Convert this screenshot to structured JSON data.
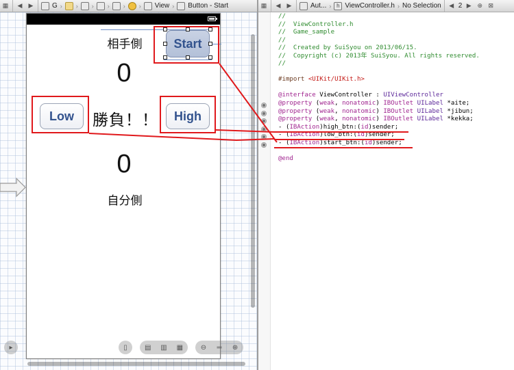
{
  "jumpbar_left": {
    "crumbs": [
      {
        "icon": "g-group-icon",
        "label": "G"
      },
      {
        "icon": "folder-icon",
        "label": ""
      },
      {
        "icon": "file-icon",
        "label": ""
      },
      {
        "icon": "storyboard-icon",
        "label": ""
      },
      {
        "icon": "scene-icon",
        "label": ""
      },
      {
        "icon": "view-controller-icon",
        "label": ""
      },
      {
        "icon": "view-icon",
        "label": "View"
      },
      {
        "icon": "button-icon",
        "label": "Button - Start"
      }
    ]
  },
  "jumpbar_right": {
    "related_label": "Aut...",
    "file_label": "ViewController.h",
    "selection_label": "No Selection",
    "counter": "2"
  },
  "storyboard": {
    "aite_label": "相手側",
    "aite_value": "0",
    "shoubu_label": "勝負！！",
    "jibun_value": "0",
    "jibun_label": "自分側",
    "low_button": "Low",
    "high_button": "High",
    "start_button": "Start"
  },
  "annotation_color": "#e0181b",
  "code_lines": [
    {
      "parts": [
        {
          "cls": "c",
          "text": "//"
        }
      ]
    },
    {
      "parts": [
        {
          "cls": "c",
          "text": "//  ViewController.h"
        }
      ]
    },
    {
      "parts": [
        {
          "cls": "c",
          "text": "//  Game_sample"
        }
      ]
    },
    {
      "parts": [
        {
          "cls": "c",
          "text": "//"
        }
      ]
    },
    {
      "parts": [
        {
          "cls": "c",
          "text": "//  Created by SuiSyou on 2013/06/15."
        }
      ]
    },
    {
      "parts": [
        {
          "cls": "c",
          "text": "//  Copyright (c) 2013年 SuiSyou. All rights reserved."
        }
      ]
    },
    {
      "parts": [
        {
          "cls": "c",
          "text": "//"
        }
      ]
    },
    {
      "parts": []
    },
    {
      "parts": [
        {
          "cls": "p",
          "text": "#import "
        },
        {
          "cls": "s",
          "text": "<UIKit/UIKit.h>"
        }
      ]
    },
    {
      "parts": []
    },
    {
      "parts": [
        {
          "cls": "k",
          "text": "@interface"
        },
        {
          "cls": "",
          "text": " ViewController : "
        },
        {
          "cls": "t",
          "text": "UIViewController"
        }
      ]
    },
    {
      "parts": [
        {
          "cls": "k",
          "text": "@property"
        },
        {
          "cls": "",
          "text": " ("
        },
        {
          "cls": "kw",
          "text": "weak"
        },
        {
          "cls": "",
          "text": ", "
        },
        {
          "cls": "kw",
          "text": "nonatomic"
        },
        {
          "cls": "",
          "text": ") "
        },
        {
          "cls": "kw",
          "text": "IBOutlet"
        },
        {
          "cls": "",
          "text": " "
        },
        {
          "cls": "t",
          "text": "UILabel"
        },
        {
          "cls": "",
          "text": " *aite;"
        }
      ]
    },
    {
      "parts": [
        {
          "cls": "k",
          "text": "@property"
        },
        {
          "cls": "",
          "text": " ("
        },
        {
          "cls": "kw",
          "text": "weak"
        },
        {
          "cls": "",
          "text": ", "
        },
        {
          "cls": "kw",
          "text": "nonatomic"
        },
        {
          "cls": "",
          "text": ") "
        },
        {
          "cls": "kw",
          "text": "IBOutlet"
        },
        {
          "cls": "",
          "text": " "
        },
        {
          "cls": "t",
          "text": "UILabel"
        },
        {
          "cls": "",
          "text": " *jibun;"
        }
      ]
    },
    {
      "parts": [
        {
          "cls": "k",
          "text": "@property"
        },
        {
          "cls": "",
          "text": " ("
        },
        {
          "cls": "kw",
          "text": "weak"
        },
        {
          "cls": "",
          "text": ", "
        },
        {
          "cls": "kw",
          "text": "nonatomic"
        },
        {
          "cls": "",
          "text": ") "
        },
        {
          "cls": "kw",
          "text": "IBOutlet"
        },
        {
          "cls": "",
          "text": " "
        },
        {
          "cls": "t",
          "text": "UILabel"
        },
        {
          "cls": "",
          "text": " *kekka;"
        }
      ]
    },
    {
      "parts": [
        {
          "cls": "",
          "text": "- ("
        },
        {
          "cls": "kw",
          "text": "IBAction"
        },
        {
          "cls": "",
          "text": ")high_btn:("
        },
        {
          "cls": "kw",
          "text": "id"
        },
        {
          "cls": "",
          "text": ")sender;"
        }
      ]
    },
    {
      "parts": [
        {
          "cls": "",
          "text": "- ("
        },
        {
          "cls": "kw",
          "text": "IBAction"
        },
        {
          "cls": "",
          "text": ")low_btn:("
        },
        {
          "cls": "kw",
          "text": "id"
        },
        {
          "cls": "",
          "text": ")sender;"
        }
      ]
    },
    {
      "parts": [
        {
          "cls": "",
          "text": "- ("
        },
        {
          "cls": "kw",
          "text": "IBAction"
        },
        {
          "cls": "",
          "text": ")start_btn:("
        },
        {
          "cls": "kw",
          "text": "id"
        },
        {
          "cls": "",
          "text": ")sender;"
        }
      ]
    },
    {
      "parts": []
    },
    {
      "parts": [
        {
          "cls": "k",
          "text": "@end"
        }
      ]
    }
  ]
}
